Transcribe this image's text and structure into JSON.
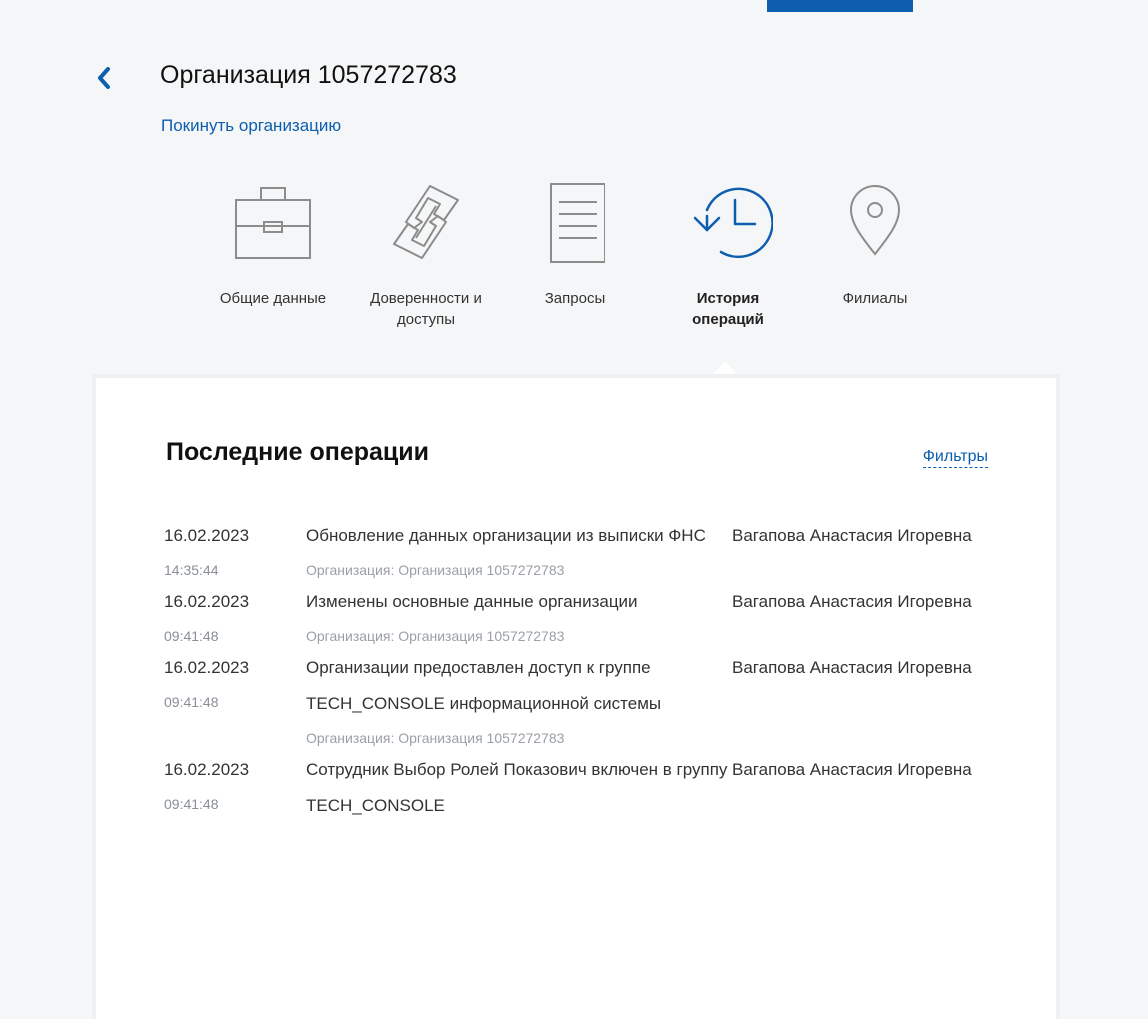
{
  "header": {
    "title": "Организация 1057272783",
    "leave_link": "Покинуть организацию"
  },
  "nav": {
    "items": [
      {
        "label": "Общие данные",
        "icon": "briefcase-icon"
      },
      {
        "label": "Доверенности и доступы",
        "icon": "link-icon"
      },
      {
        "label": "Запросы",
        "icon": "document-icon"
      },
      {
        "label": "История операций",
        "icon": "history-icon",
        "active": true
      },
      {
        "label": "Филиалы",
        "icon": "location-pin-icon"
      }
    ]
  },
  "panel": {
    "title": "Последние операции",
    "filters_label": "Фильтры",
    "operations": [
      {
        "date": "16.02.2023",
        "time": "14:35:44",
        "description": "Обновление данных организации из выписки ФНС",
        "org": "Организация: Организация 1057272783",
        "user": "Вагапова Анастасия Игоревна"
      },
      {
        "date": "16.02.2023",
        "time": "09:41:48",
        "description": "Изменены основные данные организации",
        "org": "Организация: Организация 1057272783",
        "user": "Вагапова Анастасия Игоревна"
      },
      {
        "date": "16.02.2023",
        "time": "09:41:48",
        "description": "Организации предоставлен доступ к группе TECH_CONSOLE информационной системы",
        "org": "Организация: Организация 1057272783",
        "user": "Вагапова Анастасия Игоревна"
      },
      {
        "date": "16.02.2023",
        "time": "09:41:48",
        "description": "Сотрудник Выбор Ролей Показович включен в группу TECH_CONSOLE",
        "org": "",
        "user": "Вагапова Анастасия Игоревна"
      }
    ]
  },
  "colors": {
    "accent": "#0d5eaf",
    "text": "#333333",
    "muted": "#8a8f96",
    "background": "#f5f6f7"
  }
}
